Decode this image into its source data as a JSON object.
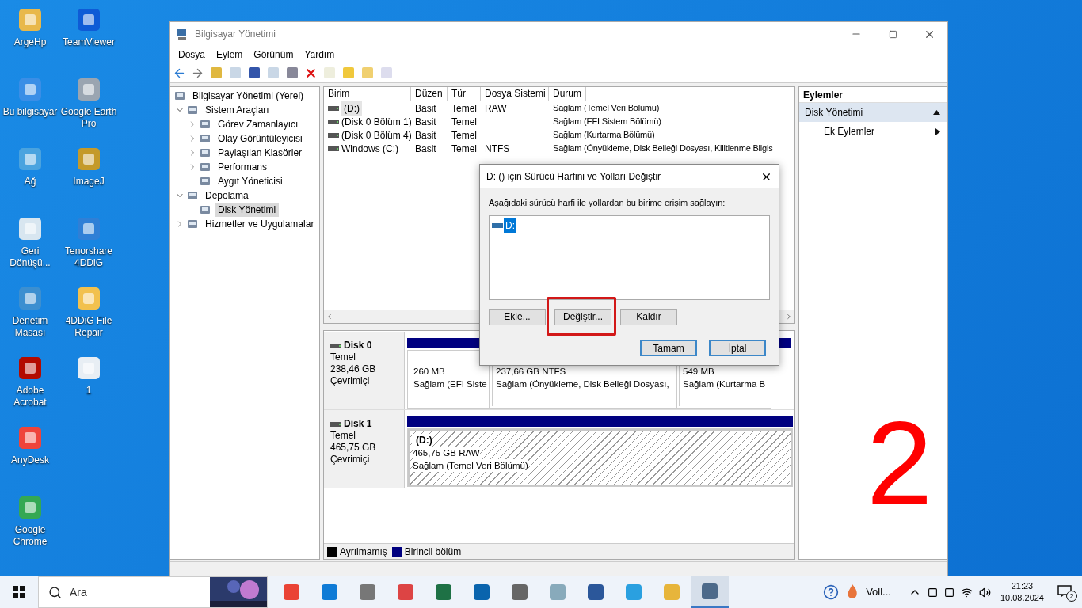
{
  "desktop_left": [
    {
      "label": "ArgeHp"
    },
    {
      "label": "Bu bilgisayar"
    },
    {
      "label": "Ağ"
    },
    {
      "label": "Geri Dönüşü..."
    },
    {
      "label": "Denetim Masası"
    },
    {
      "label": "Adobe Acrobat"
    },
    {
      "label": "AnyDesk"
    },
    {
      "label": "Google Chrome"
    }
  ],
  "desktop_right": [
    {
      "label": "TeamViewer"
    },
    {
      "label": "Google Earth Pro"
    },
    {
      "label": "ImageJ"
    },
    {
      "label": "Tenorshare 4DDiG"
    },
    {
      "label": "4DDiG File Repair"
    },
    {
      "label": "1"
    }
  ],
  "window": {
    "title": "Bilgisayar Yönetimi",
    "menu": [
      "Dosya",
      "Eylem",
      "Görünüm",
      "Yardım"
    ]
  },
  "tree": [
    {
      "label": "Bilgisayar Yönetimi (Yerel)",
      "selected": false,
      "children": [
        {
          "label": "Sistem Araçları",
          "expanded": true,
          "selected": false,
          "children": [
            {
              "label": "Görev Zamanlayıcı",
              "expanded": false,
              "selected": false
            },
            {
              "label": "Olay Görüntüleyicisi",
              "expanded": false,
              "selected": false
            },
            {
              "label": "Paylaşılan Klasörler",
              "expanded": false,
              "selected": false
            },
            {
              "label": "Performans",
              "expanded": false,
              "selected": false
            },
            {
              "label": "Aygıt Yöneticisi",
              "selected": false
            }
          ]
        },
        {
          "label": "Depolama",
          "expanded": true,
          "selected": false,
          "children": [
            {
              "label": "Disk Yönetimi",
              "selected": true
            }
          ]
        },
        {
          "label": "Hizmetler ve Uygulamalar",
          "expanded": false,
          "selected": false
        }
      ]
    }
  ],
  "table": {
    "columns": [
      "Birim",
      "Düzen",
      "Tür",
      "Dosya Sistemi",
      "Durum"
    ],
    "rows": [
      {
        "cells": [
          "(D:)",
          "Basit",
          "Temel",
          "RAW",
          "Sağlam (Temel Veri Bölümü)"
        ],
        "selected": true
      },
      {
        "cells": [
          "(Disk 0 Bölüm 1)",
          "Basit",
          "Temel",
          "",
          "Sağlam (EFI Sistem Bölümü)"
        ],
        "selected": false
      },
      {
        "cells": [
          "(Disk 0 Bölüm 4)",
          "Basit",
          "Temel",
          "",
          "Sağlam (Kurtarma Bölümü)"
        ],
        "selected": false
      },
      {
        "cells": [
          "Windows (C:)",
          "Basit",
          "Temel",
          "NTFS",
          "Sağlam (Önyükleme, Disk Belleği Dosyası, Kilitlenme Bilgis"
        ],
        "selected": false
      }
    ]
  },
  "disks": [
    {
      "name": "Disk 0",
      "type": "Temel",
      "size": "238,46 GB",
      "status": "Çevrimiçi",
      "partitions": [
        {
          "lines": [
            "260 MB",
            "Sağlam (EFI Siste"
          ],
          "selected": false
        },
        {
          "lines": [
            "237,66 GB NTFS",
            "Sağlam (Önyükleme, Disk Belleği Dosyası,"
          ],
          "selected": false
        },
        {
          "lines": [
            "549 MB",
            "Sağlam (Kurtarma B"
          ],
          "selected": false
        }
      ]
    },
    {
      "name": "Disk 1",
      "type": "Temel",
      "size": "465,75 GB",
      "status": "Çevrimiçi",
      "partitions": [
        {
          "label": "(D:)",
          "lines": [
            "465,75 GB RAW",
            "Sağlam (Temel Veri Bölümü)"
          ],
          "selected": true
        }
      ]
    }
  ],
  "legend": [
    {
      "label": "Ayrılmamış",
      "color": "#000000"
    },
    {
      "label": "Birincil bölüm",
      "color": "#000080"
    }
  ],
  "actions": {
    "title": "Eylemler",
    "items": [
      {
        "label": "Disk Yönetimi",
        "kind": "header",
        "selected": true
      },
      {
        "label": "Ek Eylemler",
        "kind": "submenu",
        "selected": false
      }
    ]
  },
  "dialog": {
    "title": "D: () için Sürücü Harfini ve Yolları Değiştir",
    "instruction": "Aşağıdaki sürücü harfi ile yollardan bu birime erişim sağlayın:",
    "paths": [
      {
        "label": "D:",
        "selected": true
      }
    ],
    "buttons": [
      {
        "label": "Ekle...",
        "default": false
      },
      {
        "label": "Değiştir...",
        "default": false
      },
      {
        "label": "Kaldır",
        "default": false
      }
    ],
    "confirm_buttons": [
      {
        "label": "Tamam",
        "default": true
      },
      {
        "label": "İptal",
        "default": true
      }
    ]
  },
  "annotation": {
    "number": "2"
  },
  "taskbar": {
    "search_placeholder": "Ara",
    "apps": [
      {
        "selected": false
      },
      {
        "selected": false
      },
      {
        "selected": false
      },
      {
        "selected": false
      },
      {
        "selected": false
      },
      {
        "selected": false
      },
      {
        "selected": false
      },
      {
        "selected": false
      },
      {
        "selected": false
      },
      {
        "selected": false
      },
      {
        "selected": false
      },
      {
        "selected": true
      }
    ],
    "tray_label": "Voll...",
    "time": "21:23",
    "date": "10.08.2024",
    "notifications": "2"
  }
}
